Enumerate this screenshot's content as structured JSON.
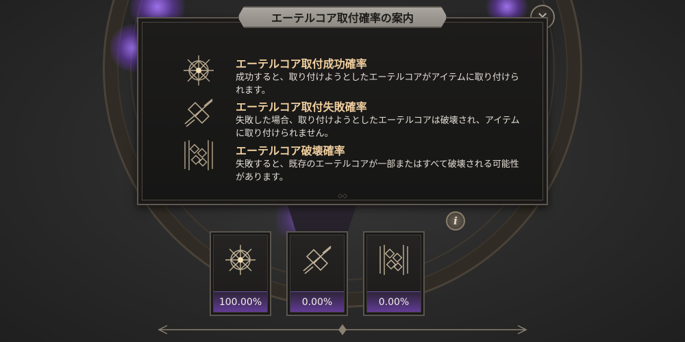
{
  "panel": {
    "title": "エーテルコア取付確率の案内",
    "entries": [
      {
        "icon": "success-rune-icon",
        "title": "エーテルコア取付成功確率",
        "desc": "成功すると、取り付けようとしたエーテルコアがアイテムに取り付けられます。"
      },
      {
        "icon": "fail-rune-icon",
        "title": "エーテルコア取付失敗確率",
        "desc": "失敗した場合、取り付けようとしたエーテルコアは破壊され、アイテムに取り付けられません。"
      },
      {
        "icon": "destroy-rune-icon",
        "title": "エーテルコア破壊確率",
        "desc": "失敗すると、既存のエーテルコアが一部またはすべて破壊される可能性があります。"
      }
    ]
  },
  "close_icon": "close-icon",
  "info_icon": "info-icon",
  "info_label": "i",
  "cards": [
    {
      "icon": "success-rune-icon",
      "value": "100.00%"
    },
    {
      "icon": "fail-rune-icon",
      "value": "0.00%"
    },
    {
      "icon": "destroy-rune-icon",
      "value": "0.00%"
    }
  ],
  "colors": {
    "title_gold": "#f1cf9f",
    "accent_purple": "#7a4bc0",
    "panel_bg": "#1b1a19"
  }
}
